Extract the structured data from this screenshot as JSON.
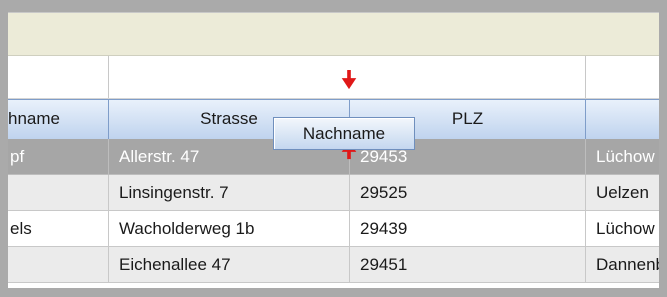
{
  "columns": {
    "col0_header": "hname",
    "col1_header": "Strasse",
    "col2_header": "PLZ",
    "col3_header": ""
  },
  "rows": [
    {
      "c0": "pf",
      "c1": "Allerstr. 47",
      "c2": "29453",
      "c3": "Lüchow"
    },
    {
      "c0": "",
      "c1": "Linsingenstr. 7",
      "c2": "29525",
      "c3": "Uelzen"
    },
    {
      "c0": "els",
      "c1": "Wacholderweg 1b",
      "c2": "29439",
      "c3": "Lüchow"
    },
    {
      "c0": "",
      "c1": "Eichenallee 47",
      "c2": "29451",
      "c3": "Dannenberg"
    }
  ],
  "drag_label": "Nachname",
  "colors": {
    "selected_row": "#a6a6a6",
    "alt_row": "#ebebeb",
    "group_band": "#ecebd8",
    "drop_marker": "#e01818",
    "header_gradient_top": "#e9f1fb",
    "header_gradient_bottom": "#bfd3ee"
  },
  "icons": [
    "drop-indicator-arrow-down",
    "drop-indicator-arrow-up"
  ]
}
